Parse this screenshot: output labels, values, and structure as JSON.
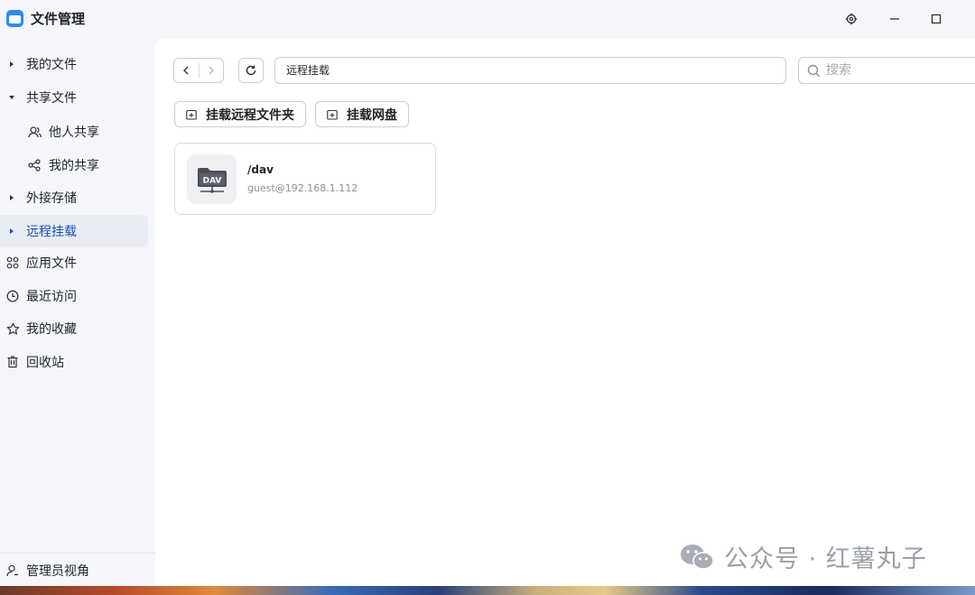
{
  "app": {
    "title": "文件管理"
  },
  "window_controls": {
    "settings_icon": "gear-icon",
    "minimize_icon": "minimize-icon",
    "maximize_icon": "maximize-icon"
  },
  "sidebar": {
    "items": [
      {
        "label": "我的文件",
        "kind": "expandable",
        "expanded": false
      },
      {
        "label": "共享文件",
        "kind": "expandable",
        "expanded": true
      },
      {
        "label": "他人共享",
        "kind": "sub",
        "icon": "people-icon"
      },
      {
        "label": "我的共享",
        "kind": "sub",
        "icon": "share-icon"
      },
      {
        "label": "外接存储",
        "kind": "expandable",
        "expanded": false
      },
      {
        "label": "远程挂载",
        "kind": "expandable",
        "expanded": false,
        "active": true
      },
      {
        "label": "应用文件",
        "kind": "icon",
        "icon": "apps-icon"
      },
      {
        "label": "最近访问",
        "kind": "icon",
        "icon": "clock-icon"
      },
      {
        "label": "我的收藏",
        "kind": "icon",
        "icon": "star-icon"
      },
      {
        "label": "回收站",
        "kind": "icon",
        "icon": "trash-icon"
      }
    ],
    "footer": {
      "label": "管理员视角",
      "icon": "admin-icon"
    }
  },
  "toolbar": {
    "path": "远程挂载",
    "search_placeholder": "搜索"
  },
  "actions": {
    "mount_remote_folder": "挂载远程文件夹",
    "mount_cloud_drive": "挂载网盘"
  },
  "mounts": [
    {
      "name": "/dav",
      "address": "guest@192.168.1.112",
      "badge": "DAV"
    }
  ],
  "watermark": {
    "text": "公众号 · 红薯丸子"
  },
  "colors": {
    "accent": "#1b4fb8",
    "active_bg": "#e8edf5",
    "app_icon": "#2b8cf4"
  }
}
